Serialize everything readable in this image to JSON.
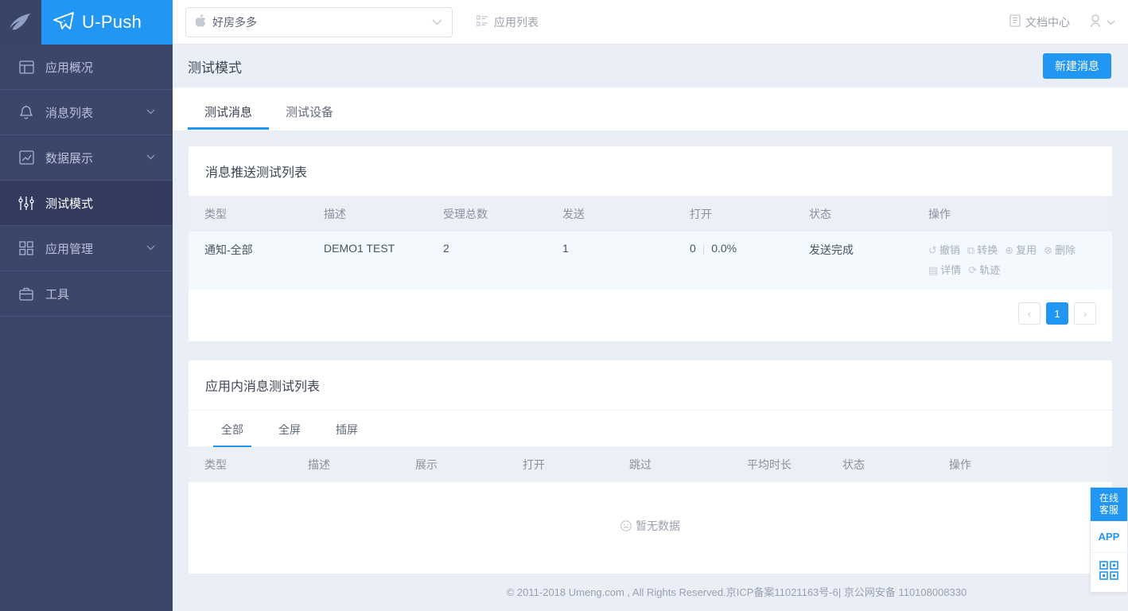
{
  "brand": {
    "name": "U-Push",
    "logo_icon": "feather-icon",
    "plane_icon": "paper-plane-icon",
    "accent": "#2196f3",
    "sidebar_bg": "#3c466b"
  },
  "topbar": {
    "app_select": {
      "value": "好房多多",
      "platform_icon": "apple-icon",
      "chevron": "chevron-down-icon"
    },
    "app_list_label": "应用列表",
    "app_list_icon": "list-icon",
    "doc_center_label": "文档中心",
    "doc_center_icon": "document-icon",
    "user_icon": "user-icon",
    "user_chevron": "chevron-down-icon"
  },
  "sidebar": {
    "items": [
      {
        "label": "应用概况",
        "icon": "dashboard-icon",
        "active": false,
        "expandable": false
      },
      {
        "label": "消息列表",
        "icon": "bell-icon",
        "active": false,
        "expandable": true
      },
      {
        "label": "数据展示",
        "icon": "chart-icon",
        "active": false,
        "expandable": true
      },
      {
        "label": "测试模式",
        "icon": "sliders-icon",
        "active": true,
        "expandable": false
      },
      {
        "label": "应用管理",
        "icon": "grid-icon",
        "active": false,
        "expandable": true
      },
      {
        "label": "工具",
        "icon": "briefcase-icon",
        "active": false,
        "expandable": false
      }
    ]
  },
  "page": {
    "title": "测试模式",
    "new_message_button": "新建消息",
    "tabs": [
      {
        "label": "测试消息",
        "active": true
      },
      {
        "label": "测试设备",
        "active": false
      }
    ]
  },
  "push_card": {
    "title": "消息推送测试列表",
    "columns": [
      "类型",
      "描述",
      "受理总数",
      "发送",
      "打开",
      "状态",
      "操作"
    ],
    "rows": [
      {
        "type": "通知-全部",
        "description": "DEMO1 TEST",
        "total": "2",
        "sent": "1",
        "opened": "0",
        "opened_rate": "0.0%",
        "status": "发送完成",
        "actions": [
          {
            "label": "撤销",
            "icon": "undo-icon"
          },
          {
            "label": "转换",
            "icon": "convert-icon"
          },
          {
            "label": "复用",
            "icon": "plus-circle-icon"
          },
          {
            "label": "删除",
            "icon": "close-circle-icon"
          },
          {
            "label": "详情",
            "icon": "detail-icon"
          },
          {
            "label": "轨迹",
            "icon": "trace-icon"
          }
        ]
      }
    ],
    "pagination": {
      "prev": "‹",
      "current": "1",
      "next": "›"
    }
  },
  "inapp_card": {
    "title": "应用内消息测试列表",
    "subtabs": [
      {
        "label": "全部",
        "active": true
      },
      {
        "label": "全屏",
        "active": false
      },
      {
        "label": "插屏",
        "active": false
      }
    ],
    "columns": [
      "类型",
      "描述",
      "展示",
      "打开",
      "跳过",
      "平均时长",
      "状态",
      "操作"
    ],
    "empty_text": "暂无数据",
    "empty_icon": "sad-face-icon"
  },
  "float_widget": {
    "service_line1": "在线",
    "service_line2": "客服",
    "app_label": "APP",
    "qr_icon": "qrcode-icon"
  },
  "footer": {
    "text": "© 2011-2018 Umeng.com , All Rights Reserved.京ICP备案11021163号-6| 京公网安备 110108008330"
  }
}
